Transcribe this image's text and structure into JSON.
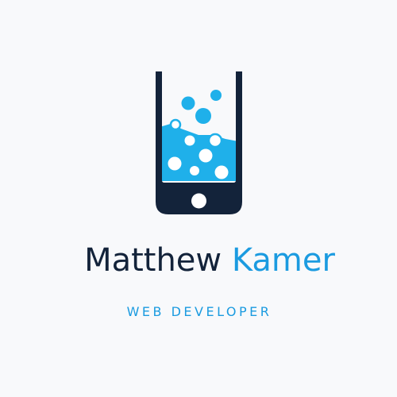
{
  "brand": {
    "first_name": "Matthew",
    "last_name": "Kamer",
    "tagline": "WEB DEVELOPER"
  },
  "colors": {
    "dark_navy": "#13233a",
    "accent_blue": "#1b9be0",
    "bubble_blue": "#1fb0ea",
    "background": "#f8f9fb",
    "bubble_white": "#ffffff"
  },
  "icons": {
    "logo": "phone-with-bubbles-icon"
  }
}
